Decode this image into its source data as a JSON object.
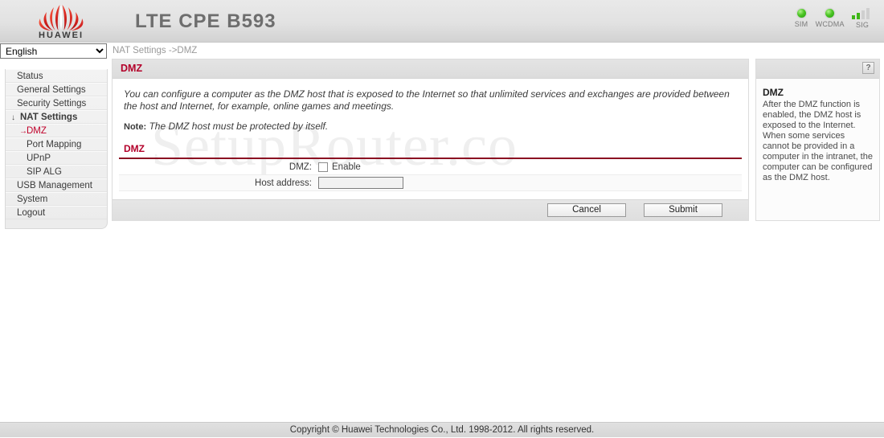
{
  "header": {
    "brand": "HUAWEI",
    "product_title": "LTE CPE B593",
    "status": [
      {
        "name": "sim",
        "label": "SIM",
        "type": "led",
        "color": "#3fb618"
      },
      {
        "name": "wcdma",
        "label": "WCDMA",
        "type": "led",
        "color": "#3fb618"
      },
      {
        "name": "sig",
        "label": "SIG",
        "type": "bars",
        "filled": 2,
        "total": 4
      }
    ]
  },
  "subbar": {
    "language": "English",
    "language_options": [
      "English"
    ],
    "breadcrumb": "NAT Settings ->DMZ"
  },
  "sidebar": {
    "items": [
      {
        "label": "Status",
        "level": 1,
        "bold": false,
        "active": false,
        "icon": ""
      },
      {
        "label": "General Settings",
        "level": 1,
        "bold": false,
        "active": false,
        "icon": ""
      },
      {
        "label": "Security Settings",
        "level": 1,
        "bold": false,
        "active": false,
        "icon": ""
      },
      {
        "label": "NAT Settings",
        "level": 1,
        "bold": true,
        "active": false,
        "icon": "arrow-down-icon"
      },
      {
        "label": "DMZ",
        "level": 2,
        "bold": false,
        "active": true,
        "icon": "arrow-right-icon"
      },
      {
        "label": "Port Mapping",
        "level": 2,
        "bold": false,
        "active": false,
        "icon": ""
      },
      {
        "label": "UPnP",
        "level": 2,
        "bold": false,
        "active": false,
        "icon": ""
      },
      {
        "label": "SIP ALG",
        "level": 2,
        "bold": false,
        "active": false,
        "icon": ""
      },
      {
        "label": "USB Management",
        "level": 1,
        "bold": false,
        "active": false,
        "icon": ""
      },
      {
        "label": "System",
        "level": 1,
        "bold": false,
        "active": false,
        "icon": ""
      },
      {
        "label": "Logout",
        "level": 1,
        "bold": false,
        "active": false,
        "icon": ""
      }
    ]
  },
  "main": {
    "title": "DMZ",
    "watermark": "SetupRouter.co",
    "intro_paragraph": "You can configure a computer as the DMZ host that is exposed to the Internet so that unlimited services and exchanges are provided between the host and Internet, for example, online games and meetings.",
    "note_label": "Note:",
    "note_text": "The DMZ host must be protected by itself.",
    "section_title": "DMZ",
    "rows": [
      {
        "label": "DMZ:",
        "field": "checkbox",
        "checkbox_text": "Enable",
        "checked": false
      },
      {
        "label": "Host address:",
        "field": "text",
        "value": "",
        "placeholder": ""
      }
    ],
    "buttons": {
      "cancel": "Cancel",
      "submit": "Submit"
    }
  },
  "help": {
    "icon": "question-mark-icon",
    "title": "DMZ",
    "text": "After the DMZ function is enabled, the DMZ host is exposed to the Internet. When some services cannot be provided in a computer in the intranet, the computer can be configured as the DMZ host."
  },
  "footer": {
    "copyright": "Copyright © Huawei Technologies Co., Ltd. 1998-2012. All rights reserved."
  },
  "theme": {
    "accent_red": "#b3002a",
    "rule_red": "#8b0f22",
    "led_green": "#3fb618",
    "header_gray": "#e2e2e2"
  }
}
